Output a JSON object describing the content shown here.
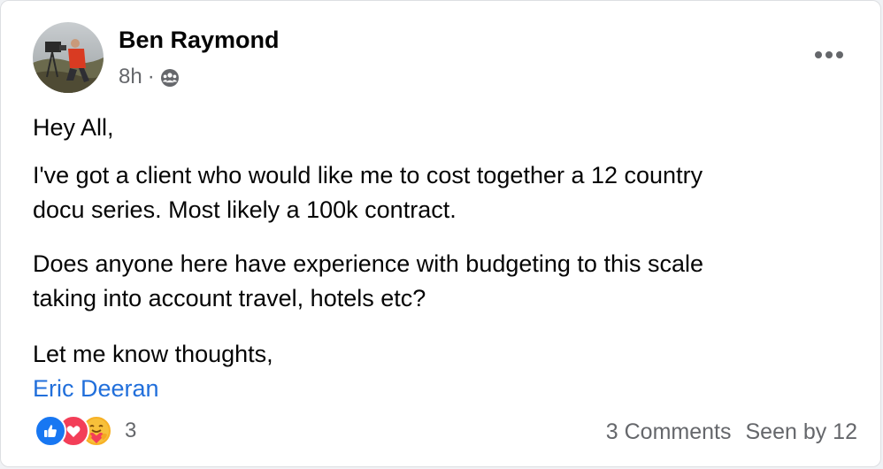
{
  "post": {
    "author": "Ben Raymond",
    "time": "8h",
    "separator": "·",
    "privacy_icon": "group-audience-icon",
    "more_icon": "more-options-icon",
    "body": {
      "greeting": "Hey All,",
      "paragraph2_line1": "I've got a client who would like me to cost together a 12 country",
      "paragraph2_line2": "docu series. Most likely a 100k contract.",
      "paragraph3_line1": "Does anyone here have experience with budgeting to this scale",
      "paragraph3_line2": "taking into account travel, hotels etc?",
      "signoff": "Let me know thoughts,",
      "tagged_name": "Eric Deeran"
    }
  },
  "footer": {
    "reaction_icons": [
      "like-icon",
      "love-icon",
      "care-icon"
    ],
    "reaction_count": "3",
    "comments": "3 Comments",
    "seen_by": "Seen by 12"
  },
  "colors": {
    "link": "#216fdb",
    "secondary_text": "#65676b",
    "like": "#1877f2",
    "love": "#f33e58",
    "care": "#f7b125"
  }
}
